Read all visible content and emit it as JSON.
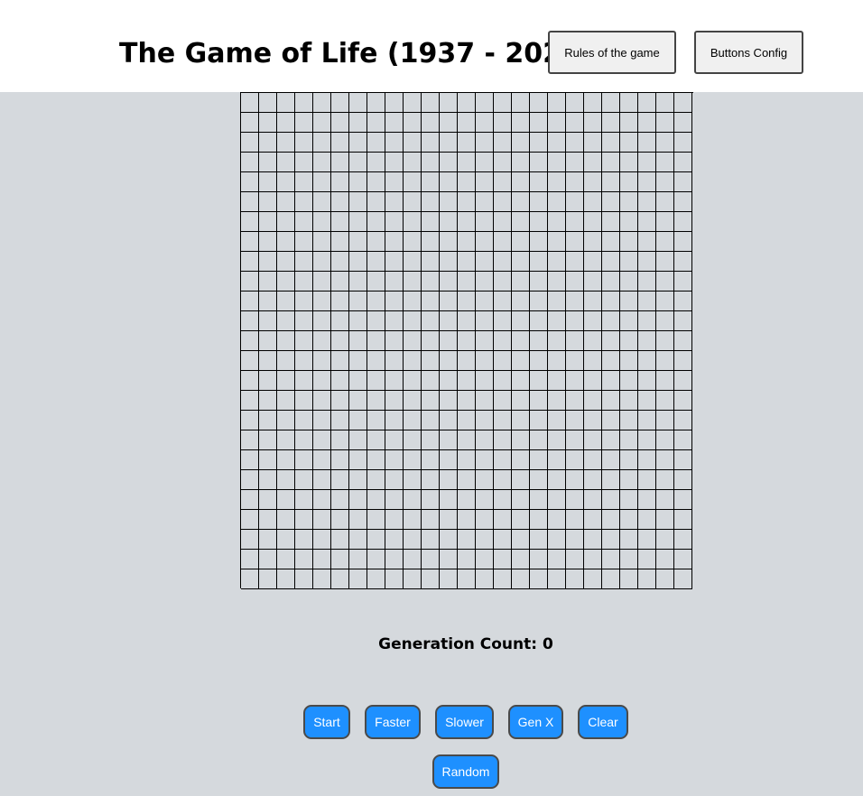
{
  "header": {
    "title": "The Game of Life (1937 - 2020)",
    "rules_button": "Rules of the game",
    "config_button": "Buttons Config"
  },
  "board": {
    "rows": 25,
    "cols": 25,
    "alive_cells": [],
    "dead_color": "#d5d9dd",
    "alive_color": "#000000",
    "line_color": "#000000"
  },
  "status": {
    "generation_label": "Generation Count:",
    "generation_count": "0"
  },
  "controls": {
    "start": "Start",
    "faster": "Faster",
    "slower": "Slower",
    "genx": "Gen X",
    "clear": "Clear",
    "random": "Random"
  },
  "colors": {
    "header_bg": "#ffffff",
    "page_bg": "#d5d9dd",
    "button_accent": "#1e90ff"
  }
}
